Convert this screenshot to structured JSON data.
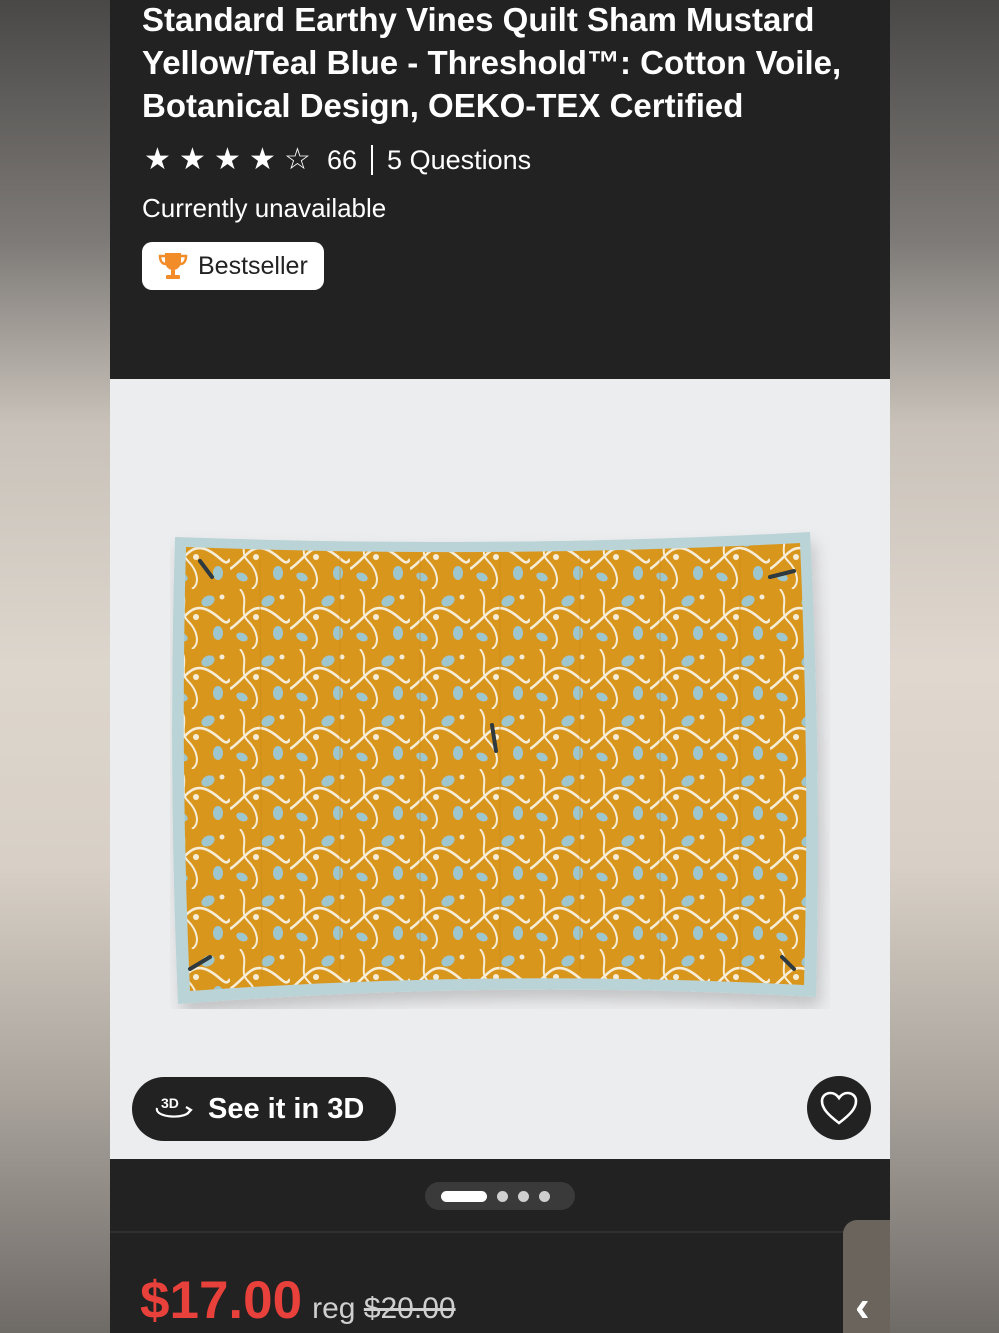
{
  "product": {
    "title": "Standard Earthy Vines Quilt Sham Mustard Yellow/Teal Blue - Threshold™: Cotton Voile, Botanical Design, OEKO-TEX Certified",
    "rating_stars": 4,
    "rating_max": 5,
    "review_count": "66",
    "questions_label": "5 Questions",
    "availability": "Currently unavailable",
    "badge_label": "Bestseller",
    "see_3d_label": "See it in 3D",
    "price": "$17.00",
    "reg_label": "reg",
    "reg_price": "$20.00"
  },
  "carousel": {
    "total_slides": 4,
    "active_index": 0
  },
  "icons": {
    "star": "star-icon",
    "trophy": "trophy-icon",
    "rotate_3d": "rotate-3d-icon",
    "heart": "heart-outline-icon",
    "chevron": "chevron-left-icon"
  },
  "colors": {
    "price_red": "#e8403a",
    "background": "#222222",
    "trophy_orange": "#f28c28",
    "mustard": "#d8991f",
    "teal": "#9ec6cf"
  }
}
